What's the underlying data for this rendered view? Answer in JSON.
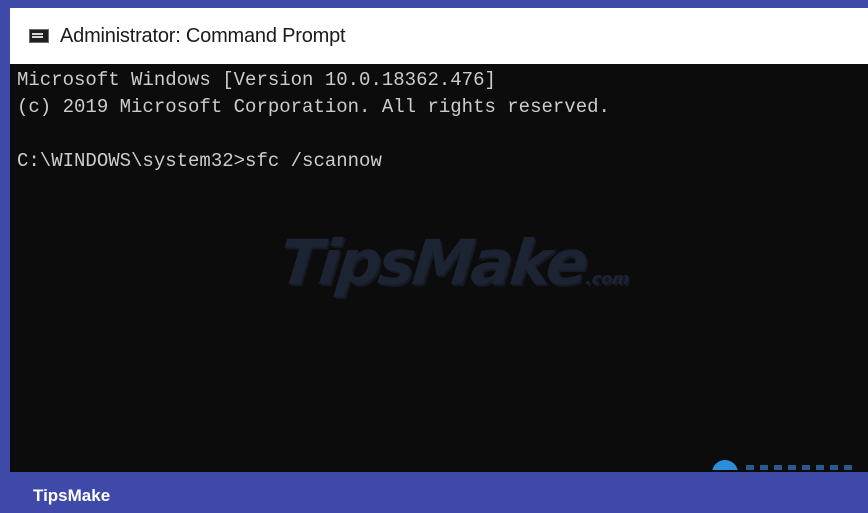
{
  "window": {
    "title": "Administrator: Command Prompt",
    "icon": "cmd-icon"
  },
  "console": {
    "lines": [
      "Microsoft Windows [Version 10.0.18362.476]",
      "(c) 2019 Microsoft Corporation. All rights reserved.",
      "",
      "C:\\WINDOWS\\system32>sfc /scannow"
    ]
  },
  "watermark": {
    "text": "TipsMake",
    "suffix": ".com"
  },
  "footer": {
    "brand": "TipsMake"
  },
  "colors": {
    "frame_border": "#3f49a8",
    "console_bg": "#0c0c0c",
    "console_text": "#cccccc",
    "titlebar_bg": "#ffffff"
  }
}
